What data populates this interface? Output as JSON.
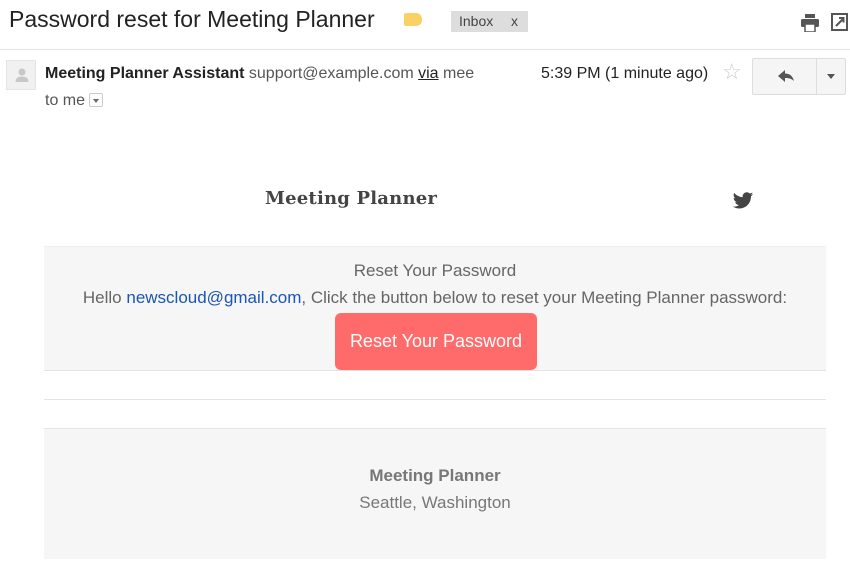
{
  "header": {
    "subject": "Password reset for Meeting Planner",
    "label_chip": "Inbox",
    "label_chip_remove": "x",
    "label_color": "#fad165",
    "icons": [
      "print-icon",
      "popout-icon"
    ]
  },
  "message": {
    "sender_name": "Meeting Planner Assistant",
    "sender_email": "support@example.com",
    "via_label": "via",
    "via_domain": "mee",
    "to_line": "to me",
    "timestamp": "5:39 PM (1 minute ago)",
    "star_icon": "star-icon",
    "reply_icon": "reply-icon",
    "more_icon": "chevron-down-icon"
  },
  "email_body": {
    "brand": "Meeting Planner",
    "social_icon": "twitter-icon",
    "heading": "Reset Your Password",
    "hello_prefix": "Hello ",
    "recipient_email": "newscloud@gmail.com",
    "hello_suffix": ", Click the button below to reset your Meeting Planner password:",
    "button_label": "Reset Your Password",
    "button_color": "#ff6b6b",
    "link_color": "#1a56b3",
    "footer_name": "Meeting Planner",
    "footer_location": "Seattle, Washington"
  }
}
